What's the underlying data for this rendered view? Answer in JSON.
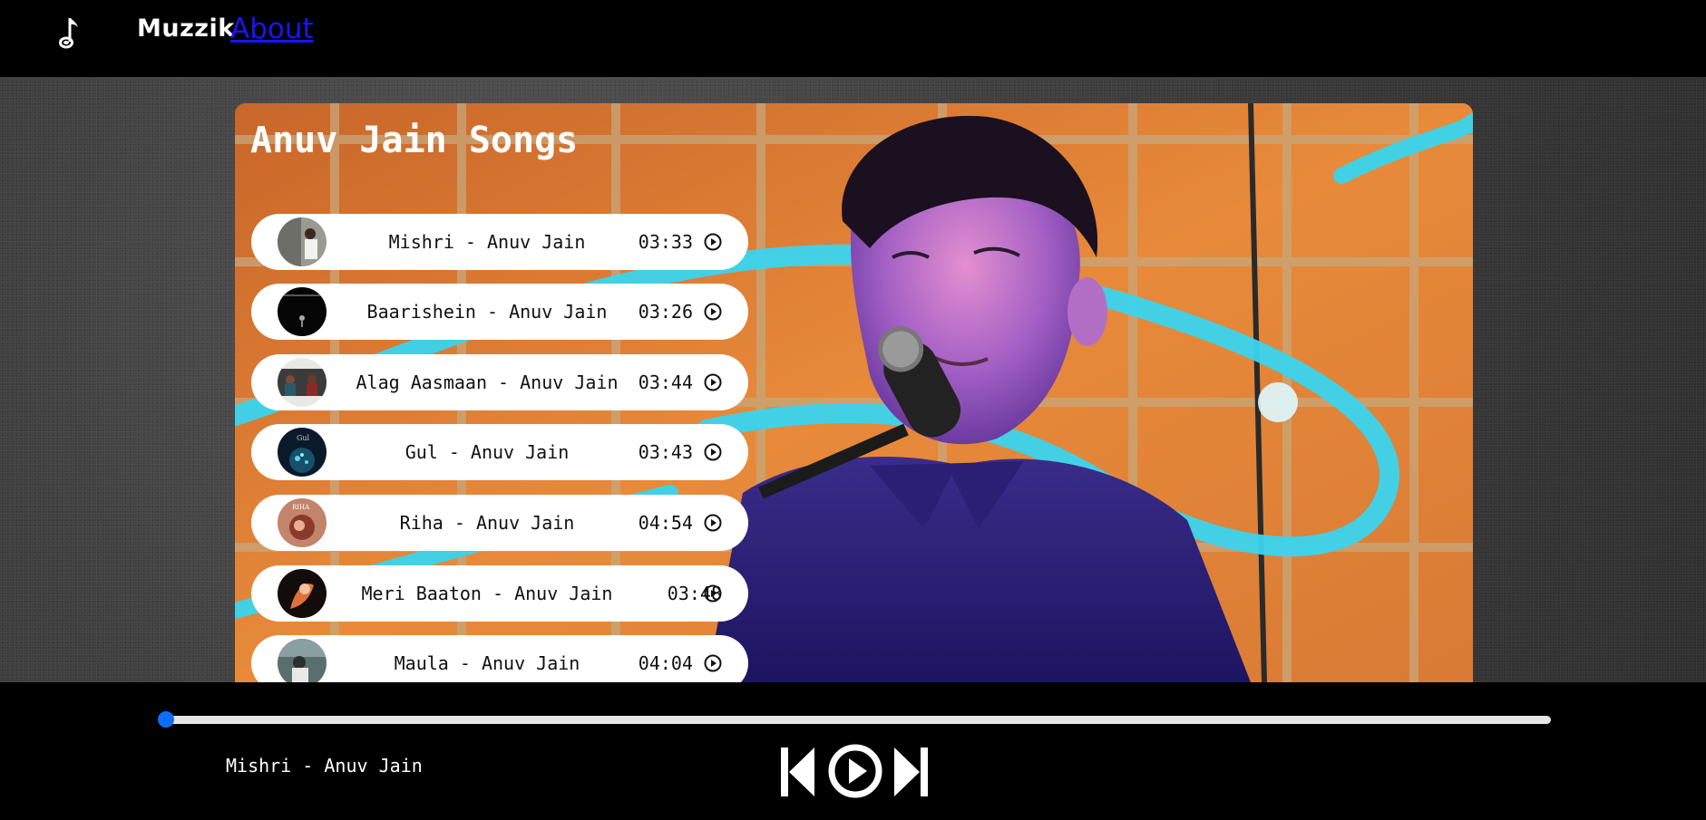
{
  "nav": {
    "brand": "Muzzik",
    "about": "About",
    "logo_icon": "music-note-icon"
  },
  "main": {
    "title": "Anuv Jain Songs",
    "songs": [
      {
        "name": "Mishri - Anuv Jain",
        "duration": "03:33"
      },
      {
        "name": "Baarishein - Anuv Jain",
        "duration": "03:26"
      },
      {
        "name": "Alag Aasmaan - Anuv Jain",
        "duration": "03:44"
      },
      {
        "name": "Gul - Anuv Jain",
        "duration": "03:43"
      },
      {
        "name": "Riha - Anuv Jain",
        "duration": "04:54"
      },
      {
        "name": "Meri Baaton - Anuv Jain",
        "duration": "03:48"
      },
      {
        "name": "Maula - Anuv Jain",
        "duration": "04:04"
      }
    ],
    "play_icon": "play-circle-icon"
  },
  "player": {
    "now_playing": "Mishri - Anuv Jain",
    "progress": 0,
    "accent_color": "#0d6efd",
    "controls": [
      "previous-icon",
      "play-icon",
      "next-icon"
    ]
  }
}
